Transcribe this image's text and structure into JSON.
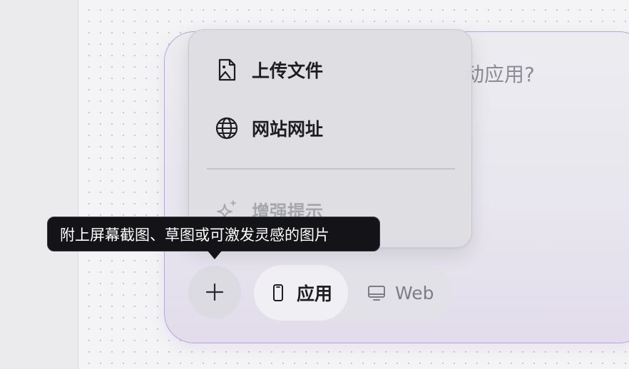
{
  "composer": {
    "placeholder_fragment": "动应用?"
  },
  "attach_menu": {
    "items": [
      {
        "label": "上传文件",
        "icon": "image-file-icon"
      },
      {
        "label": "网站网址",
        "icon": "globe-icon"
      },
      {
        "label": "增强提示",
        "icon": "sparkles-icon",
        "disabled": true
      }
    ]
  },
  "tooltip": {
    "text": "附上屏幕截图、草图或可激发灵感的图片"
  },
  "mode_toggle": {
    "options": [
      {
        "label": "应用",
        "icon": "mobile-phone-icon",
        "selected": true
      },
      {
        "label": "Web",
        "icon": "desktop-monitor-icon",
        "selected": false
      }
    ]
  },
  "colors": {
    "composer_border": "#b9a5dd",
    "tooltip_bg": "#141418",
    "menu_bg": "#dddde2"
  }
}
